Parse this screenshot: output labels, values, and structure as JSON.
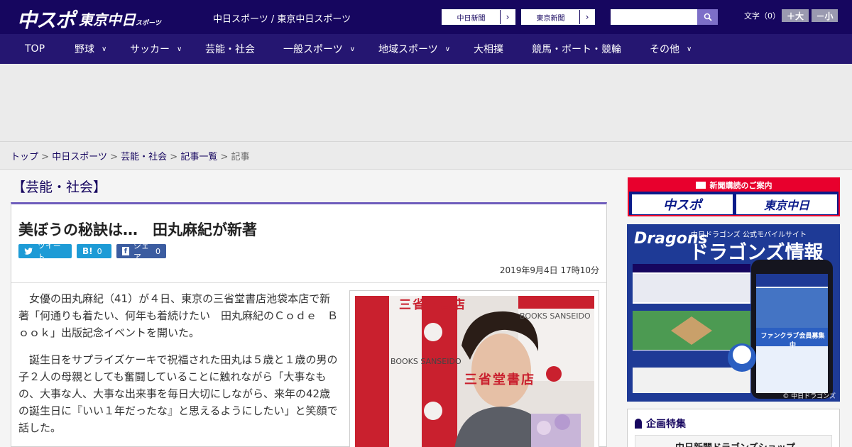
{
  "header": {
    "logo_chuspo": "中スポ",
    "logo_tokyo": "東京中日",
    "logo_tokyo_small": "スポーツ",
    "site_names": "中日スポーツ / 東京中日スポーツ",
    "link1": "中日新聞",
    "link2": "東京新聞",
    "fontsize_label": "文字（0）",
    "font_big": "＋大",
    "font_small": "－小"
  },
  "nav": {
    "items": [
      "TOP",
      "野球",
      "サッカー",
      "芸能・社会",
      "一般スポーツ",
      "地域スポーツ",
      "大相撲",
      "競馬・ボート・競輪",
      "その他"
    ]
  },
  "breadcrumb": {
    "top": "トップ",
    "chunichi": "中日スポーツ",
    "category": "芸能・社会",
    "list": "記事一覧",
    "current": "記事",
    "sep": ">"
  },
  "article": {
    "category_label": "【芸能・社会】",
    "headline": "美ぼうの秘訣は…　田丸麻紀が新著",
    "tweet": "ツイート",
    "hatena": "B!",
    "hatena_count": "0",
    "fb_share": "シェア",
    "fb_count": "0",
    "date": "2019年9月4日 17時10分",
    "para1": "女優の田丸麻紀（41）が４日、東京の三省堂書店池袋本店で新著「何通りも着たい、何年も着続けたい　田丸麻紀のＣｏｄｅ　Ｂｏｏｋ」出版記念イベントを開いた。",
    "para2": "誕生日をサプライズケーキで祝福された田丸は５歳と１歳の男の子２人の母親としても奮闘していることに触れながら「大事なもの、大事な人、大事な出来事を毎日大切にしながら、来年の42歳の誕生日に『いい１年だったな』と思えるようにしたい」と笑顔で話した。",
    "photo_sign1": "三省堂書店",
    "photo_sign2": "BOOKS SANSEIDO"
  },
  "sidebar": {
    "subscription_header": "新聞購読のご案内",
    "sub_chuspo": "中スポ",
    "sub_tokyo": "東京中日",
    "dragons_logo": "Dragons",
    "dragons_sub": "中日ドラゴンズ 公式モバイルサイト",
    "dragons_title": "ドラゴンズ情報",
    "dragons_copy": "© 中日ドラゴンズ",
    "fanclub": "ファンクラブ会員募集中",
    "kikaku_header": "企画特集",
    "kikaku_item": "中日新聞ドラゴンズショップ"
  },
  "colors": {
    "header_bg": "#16065f",
    "nav_bg": "#251671",
    "accent": "#6e5cbc",
    "twitter": "#1d9bd6",
    "hatena": "#1d9bd6",
    "facebook": "#3b5ca0",
    "sub_red": "#e8002d"
  }
}
